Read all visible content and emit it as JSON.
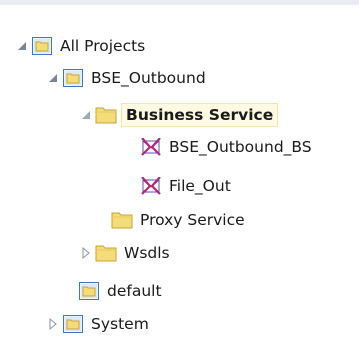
{
  "tree": {
    "root": {
      "label": "All Projects",
      "expanded": true
    },
    "project": {
      "label": "BSE_Outbound",
      "expanded": true
    },
    "business_service": {
      "label": "Business Service",
      "expanded": true,
      "selected": true
    },
    "bs_item_1": {
      "label": "BSE_Outbound_BS"
    },
    "bs_item_2": {
      "label": "File_Out"
    },
    "proxy_service": {
      "label": "Proxy Service"
    },
    "wsdls": {
      "label": "Wsdls",
      "expanded": false
    },
    "default": {
      "label": "default"
    },
    "system": {
      "label": "System",
      "expanded": false
    }
  },
  "icons": {
    "project_folder": "project-folder-icon",
    "folder": "folder-icon",
    "service": "business-service-icon",
    "expanded": "triangle-expanded-icon",
    "collapsed": "triangle-collapsed-icon"
  },
  "colors": {
    "folder_fill": "#f5dc7a",
    "folder_border": "#c9a23a",
    "project_frame": "#3a78c2",
    "twisty": "#7a8793",
    "selection_bg": "#fffbe2"
  }
}
